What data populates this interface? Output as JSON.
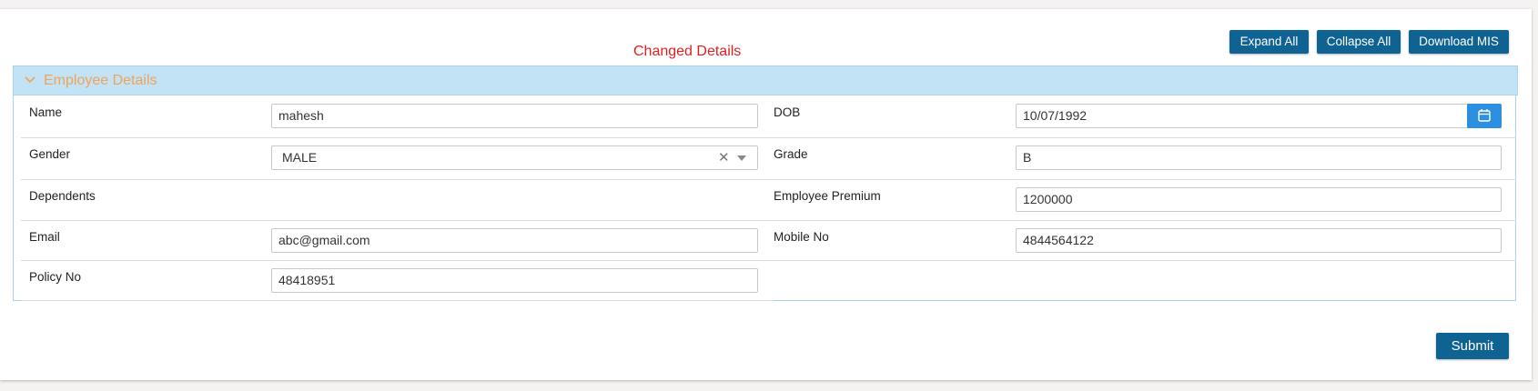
{
  "header": {
    "title": "Changed Details",
    "buttons": {
      "expand_all": "Expand All",
      "collapse_all": "Collapse All",
      "download_mis": "Download MIS"
    }
  },
  "panel": {
    "title": "Employee Details",
    "fields": {
      "name": {
        "label": "Name",
        "value": "mahesh"
      },
      "dob": {
        "label": "DOB",
        "value": "10/07/1992"
      },
      "gender": {
        "label": "Gender",
        "value": "MALE"
      },
      "grade": {
        "label": "Grade",
        "value": "B"
      },
      "dependents": {
        "label": "Dependents"
      },
      "employee_premium": {
        "label": "Employee Premium",
        "value": "1200000"
      },
      "email": {
        "label": "Email",
        "value": "abc@gmail.com"
      },
      "mobile_no": {
        "label": "Mobile No",
        "value": "4844564122"
      },
      "policy_no": {
        "label": "Policy No",
        "value": "48418951"
      }
    }
  },
  "footer": {
    "submit": "Submit"
  },
  "icons": {
    "chevron": "chevron-down-icon",
    "calendar": "calendar-icon",
    "clear": "clear-icon",
    "dropdown": "dropdown-arrow-icon"
  },
  "colors": {
    "accent": "#0e6393",
    "title_red": "#e0201f",
    "panel_header_bg": "#c1e3f5",
    "panel_header_text": "#f0a35a",
    "calendar_button": "#2d8fe0"
  }
}
